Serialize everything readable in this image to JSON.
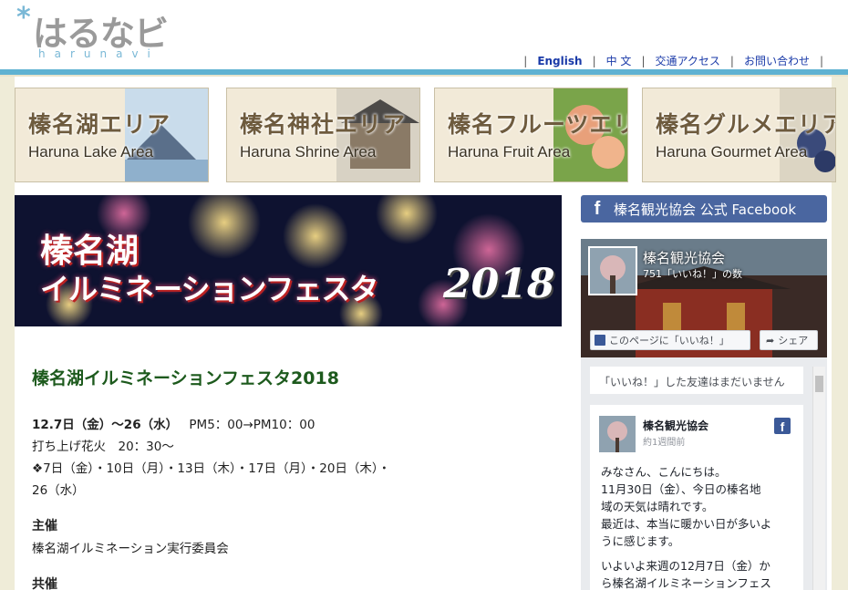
{
  "header": {
    "logo_star": "*",
    "logo_text": "はるなビ",
    "logo_sub": "harunavi",
    "nav": [
      {
        "label": "English"
      },
      {
        "label": "中 文"
      },
      {
        "label": "交通アクセス"
      },
      {
        "label": "お問い合わせ"
      }
    ],
    "nav_separator": "|"
  },
  "areas": [
    {
      "jp": "榛名湖エリア",
      "en": "Haruna Lake Area"
    },
    {
      "jp": "榛名神社エリア",
      "en": "Haruna Shrine Area"
    },
    {
      "jp": "榛名フルーツエリア",
      "en": "Haruna Fruit Area"
    },
    {
      "jp": "榛名グルメエリア",
      "en": "Haruna Gourmet Area"
    }
  ],
  "hero": {
    "line1": "榛名湖",
    "line2": "イルミネーションフェスタ",
    "year": "2018"
  },
  "article": {
    "title": "榛名湖イルミネーションフェスタ2018",
    "date_bold": "12.7日（金）～26（水）",
    "time": "PM5：00→PM10：00",
    "fireworks": "打ち上げ花火　20：30～",
    "dates_line1": "❖7日（金）・10日（月）・13日（木）・17日（月）・20日（木）・",
    "dates_line2": "26（水）",
    "organizer_label": "主催",
    "organizer": "榛名湖イルミネーション実行委員会",
    "cosponsor_label": "共催"
  },
  "sidebar": {
    "fb_button_icon": "f",
    "fb_button_label": "榛名観光協会 公式 Facebook",
    "page_name": "榛名観光協会",
    "likes": "751「いいね！」の数",
    "like_button": "このページに「いいね！」",
    "share_button": "シェア",
    "friends_text": "「いいね！」した友達はまだいません",
    "post": {
      "author": "榛名観光協会",
      "time": "約1週間前",
      "lines": [
        "みなさん、こんにちは。",
        "11月30日（金）、今日の榛名地",
        "域の天気は晴れです。",
        "最近は、本当に暖かい日が多いよ",
        "うに感じます。"
      ],
      "lines2": [
        "いよいよ来週の12月7日（金）か",
        "ら榛名湖イルミネーションフェス"
      ]
    }
  },
  "colors": {
    "header_bar": "#5fb2d2",
    "nav_link": "#1a3aa8",
    "title_green": "#1d5a1d",
    "fb_blue": "#4a66a0"
  },
  "icons": {
    "facebook_button": "facebook-f-icon",
    "facebook_post": "facebook-logo-icon",
    "share": "share-arrow-icon",
    "like": "facebook-like-icon"
  }
}
